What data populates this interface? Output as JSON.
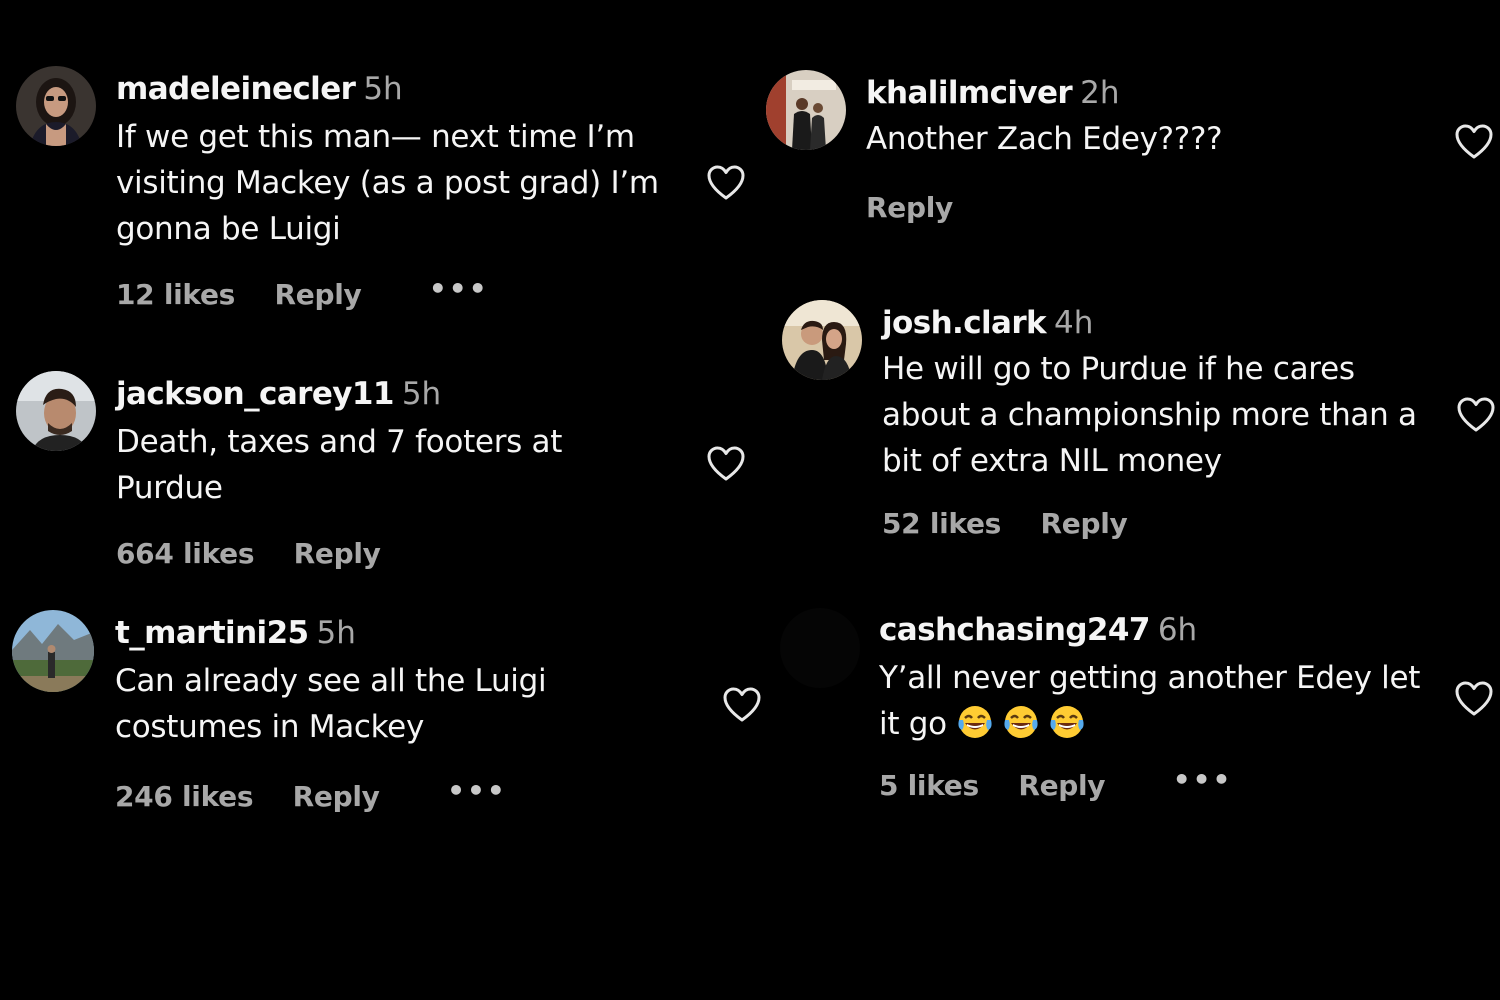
{
  "comments": [
    {
      "username": "madeleinecler",
      "time": "5h",
      "text": "If we get this man— next time I’m visiting Mackey (as a post grad) I’m gonna be Luigi",
      "likes": "12 likes",
      "reply": "Reply",
      "more": "•••"
    },
    {
      "username": "jackson_carey11",
      "time": "5h",
      "text": "Death, taxes and 7 footers at Purdue",
      "likes": "664 likes",
      "reply": "Reply"
    },
    {
      "username": "t_martini25",
      "time": "5h",
      "text": "Can already see all the Luigi costumes in Mackey",
      "likes": "246 likes",
      "reply": "Reply",
      "more": "•••"
    },
    {
      "username": "khalilmciver",
      "time": "2h",
      "text": "Another Zach Edey????",
      "reply": "Reply"
    },
    {
      "username": "josh.clark",
      "time": "4h",
      "text": "He will go to Purdue if he cares about a championship more than a bit of extra NIL money",
      "likes": "52 likes",
      "reply": "Reply"
    },
    {
      "username": "cashchasing247",
      "time": "6h",
      "text": "Y’all never getting another Edey let it go",
      "emojis": [
        "laughing-crying-emoji",
        "laughing-crying-emoji",
        "laughing-crying-emoji"
      ],
      "likes": "5 likes",
      "reply": "Reply",
      "more": "•••"
    }
  ],
  "colors": {
    "background": "#000000",
    "primary_text": "#f5f5f5",
    "secondary_text": "#a8a8a8"
  },
  "icons": {
    "like": "heart-outline-icon",
    "more": "more-options-icon"
  }
}
